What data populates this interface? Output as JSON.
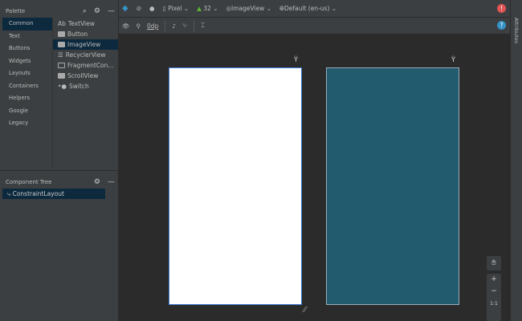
{
  "palette": {
    "title": "Palette",
    "categories": [
      "Common",
      "Text",
      "Buttons",
      "Widgets",
      "Layouts",
      "Containers",
      "Helpers",
      "Google",
      "Legacy"
    ],
    "items": [
      {
        "label": "TextView",
        "icon": "Ab"
      },
      {
        "label": "Button"
      },
      {
        "label": "ImageView"
      },
      {
        "label": "RecyclerView"
      },
      {
        "label": "FragmentCon..."
      },
      {
        "label": "ScrollView"
      },
      {
        "label": "Switch"
      }
    ]
  },
  "component_tree": {
    "title": "Component Tree",
    "root": "ConstraintLayout"
  },
  "toolbar": {
    "device": "Pixel",
    "api": "32",
    "theme": "ImageView",
    "locale": "Default (en-us)",
    "margin": "0dp"
  },
  "right_panel": {
    "label": "Attributes"
  },
  "zoom_controls": {
    "plus": "+",
    "minus": "−",
    "one_to_one": "1:1"
  },
  "colors": {
    "accent": "#3592c4",
    "blueprint": "#235b6e",
    "error": "#e05555"
  }
}
